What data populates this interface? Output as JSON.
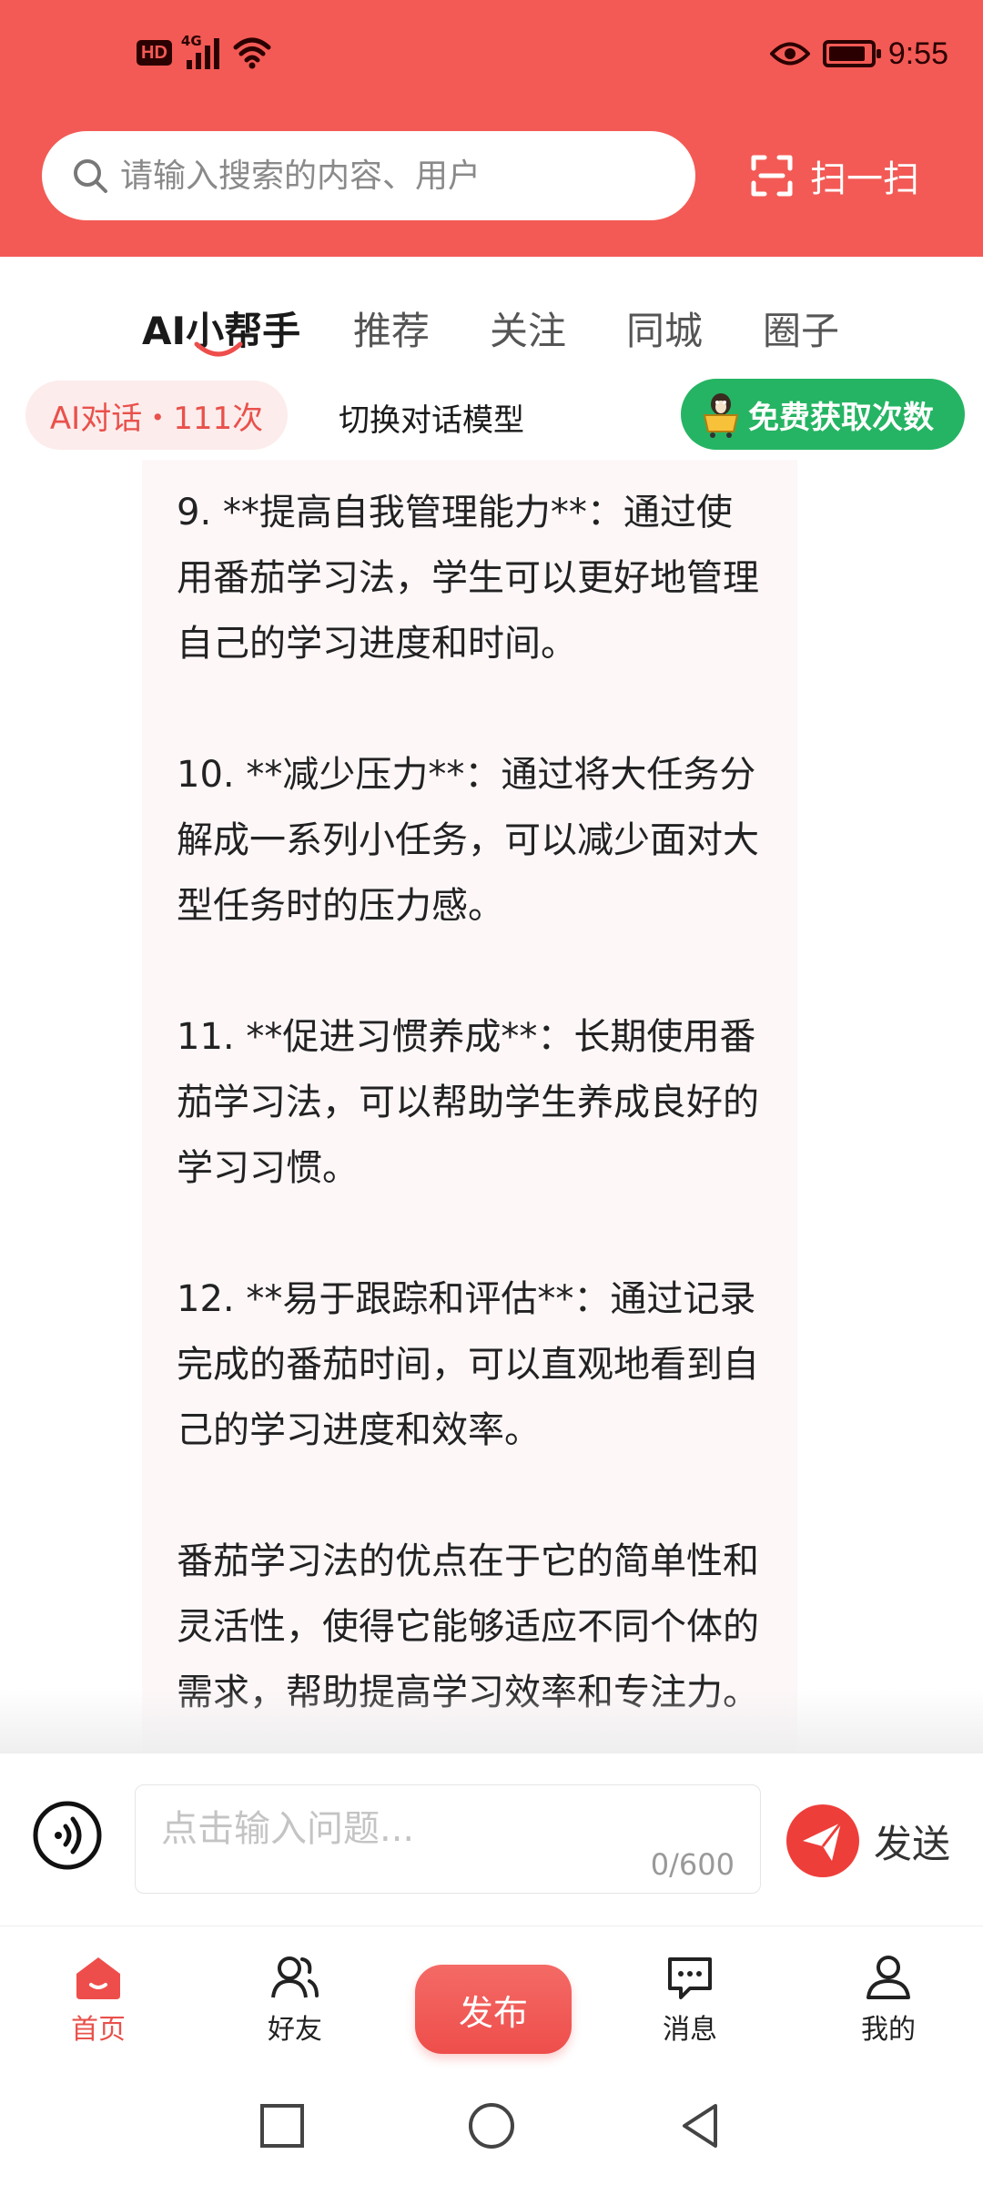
{
  "status_bar": {
    "hd": "HD",
    "network": "4G",
    "time": "9:55",
    "battery_level": 0.9
  },
  "search": {
    "placeholder": "请输入搜索的内容、用户",
    "scan_label": "扫一扫"
  },
  "tabs": [
    {
      "label": "AI小帮手",
      "active": true
    },
    {
      "label": "推荐",
      "active": false
    },
    {
      "label": "关注",
      "active": false
    },
    {
      "label": "同城",
      "active": false
    },
    {
      "label": "圈子",
      "active": false
    }
  ],
  "ai_bar": {
    "dialog_count_label": "AI对话・111次",
    "switch_model_label": "切换对话模型",
    "free_button_label": "免费获取次数"
  },
  "chat": {
    "paragraphs": [
      "9. **提高自我管理能力**：通过使用番茄学习法，学生可以更好地管理自己的学习进度和时间。",
      "10. **减少压力**：通过将大任务分解成一系列小任务，可以减少面对大型任务时的压力感。",
      "11. **促进习惯养成**：长期使用番茄学习法，可以帮助学生养成良好的学习习惯。",
      "12. **易于跟踪和评估**：通过记录完成的番茄时间，可以直观地看到自己的学习进度和效率。",
      "番茄学习法的优点在于它的简单性和灵活性，使得它能够适应不同个体的需求，帮助提高学习效率和专注力。"
    ]
  },
  "input": {
    "placeholder": "点击输入问题...",
    "char_count": "0/600",
    "send_label": "发送"
  },
  "bottom_nav": {
    "home": "首页",
    "friends": "好友",
    "publish": "发布",
    "messages": "消息",
    "mine": "我的"
  },
  "colors": {
    "brand_red": "#f35a55",
    "accent_green": "#25b463",
    "bubble_bg": "#fdf7f8"
  }
}
